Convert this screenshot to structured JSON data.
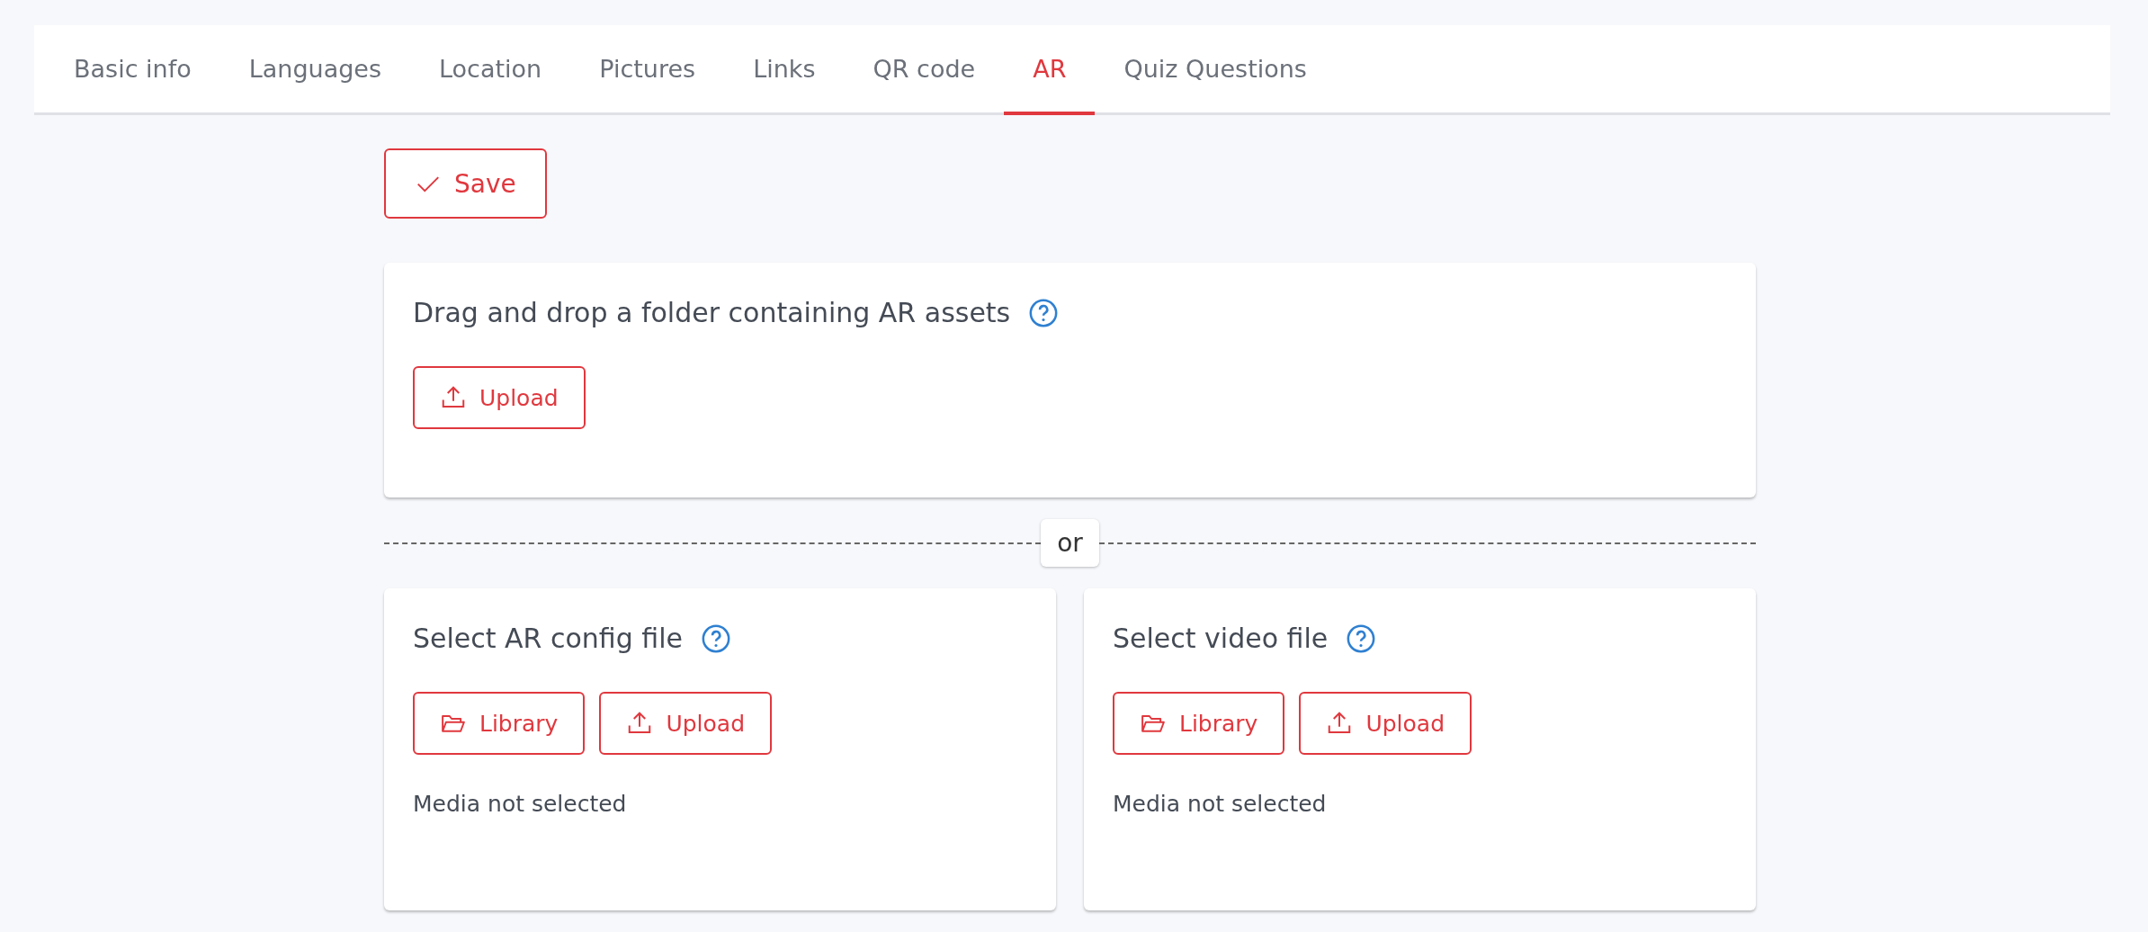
{
  "tabs": [
    {
      "label": "Basic info",
      "selected": false
    },
    {
      "label": "Languages",
      "selected": false
    },
    {
      "label": "Location",
      "selected": false
    },
    {
      "label": "Pictures",
      "selected": false
    },
    {
      "label": "Links",
      "selected": false
    },
    {
      "label": "QR code",
      "selected": false
    },
    {
      "label": "AR",
      "selected": true
    },
    {
      "label": "Quiz Questions",
      "selected": false
    }
  ],
  "save_button": {
    "label": "Save",
    "kind": "check"
  },
  "folder_card": {
    "title": "Drag and drop a folder containing AR assets",
    "buttons": [
      {
        "label": "Upload",
        "kind": "upload"
      }
    ]
  },
  "separator": {
    "label": "or"
  },
  "file_cards": [
    {
      "title": "Select AR config file",
      "buttons": [
        {
          "label": "Library",
          "kind": "folder"
        },
        {
          "label": "Upload",
          "kind": "upload"
        }
      ],
      "status": "Media not selected"
    },
    {
      "title": "Select video file",
      "buttons": [
        {
          "label": "Library",
          "kind": "folder"
        },
        {
          "label": "Upload",
          "kind": "upload"
        }
      ],
      "status": "Media not selected"
    }
  ]
}
